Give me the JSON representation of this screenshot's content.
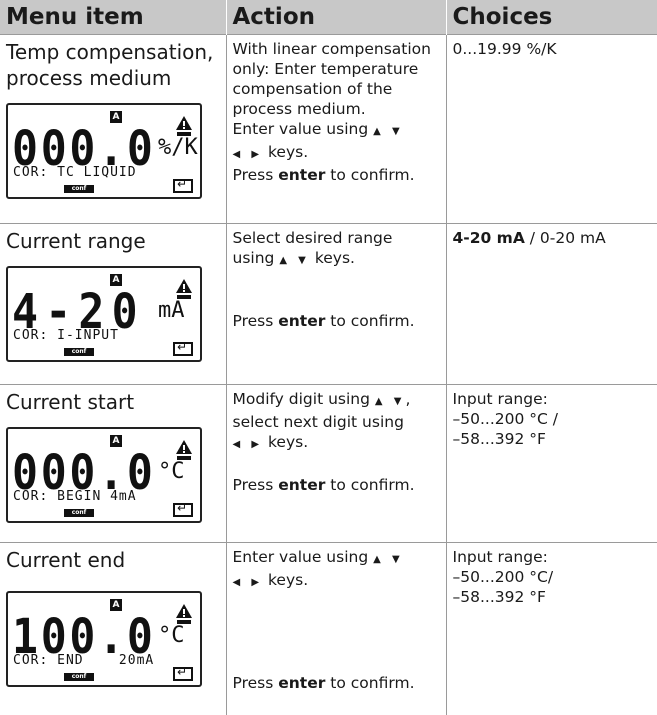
{
  "headers": {
    "menu_item": "Menu item",
    "action": "Action",
    "choices": "Choices"
  },
  "rows": [
    {
      "item": "Temp compensation, process medium",
      "display": {
        "main": "000.0",
        "unit": "%/K",
        "sub": "COR: TC LIQUID",
        "mode": "conf"
      },
      "action_lines": [
        "With linear compensation",
        "only: Enter temperature",
        "compensation of the",
        "process medium.",
        "Enter value using"
      ],
      "keys_updown": "▲ ▼",
      "keys_leftright": "◀ ▶",
      "keys_suffix": "keys.",
      "confirm_pre": "Press ",
      "confirm_key": "enter",
      "confirm_post": " to confirm.",
      "choices": "0...19.99 %/K"
    },
    {
      "item": "Current range",
      "display": {
        "main": "4-20",
        "unit": "mA",
        "sub": "COR: I-INPUT",
        "mode": "conf"
      },
      "action_lines": [
        "Select desired range",
        "using"
      ],
      "keys_updown": "▲ ▼",
      "keys_suffix": "keys.",
      "confirm_pre": "Press ",
      "confirm_key": "enter",
      "confirm_post": " to confirm.",
      "choices_bold": "4-20 mA",
      "choices_rest": " / 0-20 mA"
    },
    {
      "item": "Current start",
      "display": {
        "main": "000.0",
        "unit": "°C",
        "sub": "COR: BEGIN 4mA",
        "mode": "conf"
      },
      "action_lines": [
        "Modify digit using",
        "select next digit using"
      ],
      "keys_updown": "▲ ▼",
      "keys_leftright": "◀ ▶",
      "keys_suffix": "keys.",
      "confirm_pre": "Press ",
      "confirm_key": "enter",
      "confirm_post": " to confirm.",
      "choices_lines": [
        "Input range:",
        "–50...200 °C /",
        "–58...392 °F"
      ]
    },
    {
      "item": "Current end",
      "display": {
        "main": "100.0",
        "unit": "°C",
        "sub": "COR: END    20mA",
        "mode": "conf"
      },
      "action_lines": [
        "Enter value using"
      ],
      "keys_updown": "▲ ▼",
      "keys_leftright": "◀ ▶",
      "keys_suffix": "keys.",
      "confirm_pre": "Press ",
      "confirm_key": "enter",
      "confirm_post": " to confirm.",
      "choices_lines": [
        "Input range:",
        "–50...200 °C/",
        "–58...392 °F"
      ]
    }
  ],
  "lcd_flag": "A",
  "colors": {
    "header_bg": "#c8c8c8",
    "rule": "#9a9a9a",
    "text": "#1a1a1a"
  }
}
